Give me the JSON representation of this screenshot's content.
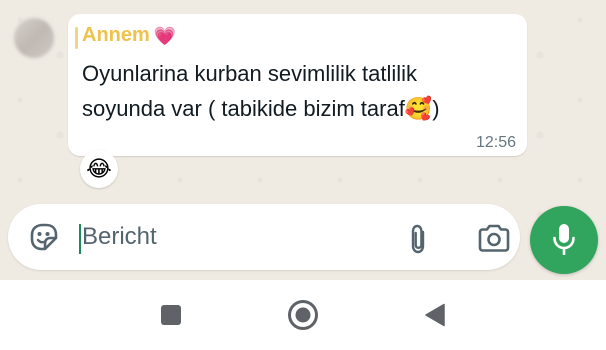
{
  "message": {
    "sender": "Annem",
    "sender_emoji": "💗",
    "text_line1": "Oyunlarina kurban sevimlilik tatlilik",
    "text_line2": "soyunda var ( tabikide bizim taraf",
    "text_emoji": "🥰",
    "text_end": ")",
    "time": "12:56",
    "reaction": "😂"
  },
  "composer": {
    "placeholder": "Bericht"
  },
  "icons": {
    "sticker": "sticker-icon",
    "attach": "paperclip-icon",
    "camera": "camera-icon",
    "mic": "microphone-icon",
    "nav_recents": "square-icon",
    "nav_home": "circle-icon",
    "nav_back": "triangle-back-icon"
  },
  "colors": {
    "chat_background": "#efeae2",
    "bubble": "#ffffff",
    "sender_name": "#f0c24b",
    "accent_green": "#31a55d",
    "time_text": "#667781"
  }
}
